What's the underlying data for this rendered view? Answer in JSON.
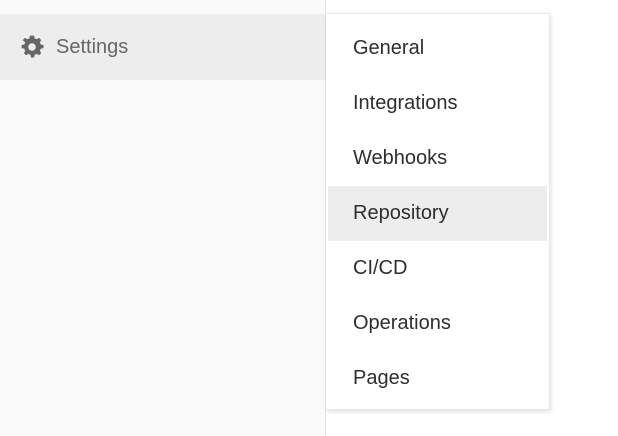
{
  "sidebar": {
    "settings": {
      "label": "Settings",
      "icon": "gear-icon"
    }
  },
  "flyout": {
    "items": [
      {
        "label": "General",
        "active": false
      },
      {
        "label": "Integrations",
        "active": false
      },
      {
        "label": "Webhooks",
        "active": false
      },
      {
        "label": "Repository",
        "active": true
      },
      {
        "label": "CI/CD",
        "active": false
      },
      {
        "label": "Operations",
        "active": false
      },
      {
        "label": "Pages",
        "active": false
      }
    ]
  },
  "colors": {
    "sidebar_bg": "#fafafa",
    "hover_bg": "#ededed",
    "icon": "#666666",
    "text": "#2e2e2e"
  }
}
